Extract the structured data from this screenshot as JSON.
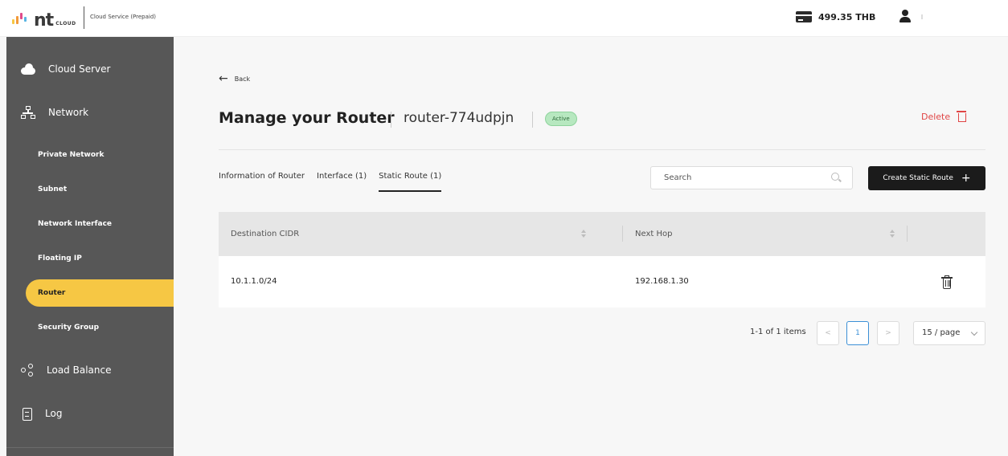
{
  "header": {
    "logo_text": "nt",
    "logo_sub": "CLOUD",
    "service": "Cloud Service (Prepaid)",
    "balance": "499.35 THB",
    "logo_colors": [
      "#f6c744",
      "#f29a3a",
      "#e04a8a",
      "#58b4e3"
    ]
  },
  "sidebar": {
    "items": [
      {
        "label": "Cloud Server",
        "icon": "cloud-icon"
      },
      {
        "label": "Network",
        "icon": "network-icon"
      },
      {
        "label": "Private Network"
      },
      {
        "label": "Subnet"
      },
      {
        "label": "Network Interface"
      },
      {
        "label": "Floating IP"
      },
      {
        "label": "Router",
        "active": true
      },
      {
        "label": "Security Group"
      },
      {
        "label": "Load Balance",
        "icon": "share-icon"
      },
      {
        "label": "Log",
        "icon": "clipboard-icon"
      }
    ]
  },
  "main": {
    "back_label": "Back",
    "title": "Manage your Router",
    "router_name": "router-774udpjn",
    "status": "Active",
    "delete_label": "Delete",
    "tabs": [
      {
        "label": "Information of Router"
      },
      {
        "label": "Interface (1)"
      },
      {
        "label": "Static Route (1)",
        "active": true
      }
    ],
    "search": {
      "placeholder": "Search"
    },
    "create_label": "Create Static Route",
    "create_plus": "+",
    "table": {
      "columns": [
        "Destination CIDR",
        "Next Hop"
      ],
      "rows": [
        {
          "destination": "10.1.1.0/24",
          "next_hop": "192.168.1.30"
        }
      ]
    },
    "pagination": {
      "info": "1-1 of 1 items",
      "prev": "<",
      "current": "1",
      "next": ">",
      "page_size": "15 / page"
    }
  },
  "colors": {
    "sidebar_bg": "#575757",
    "active_item": "#f6c744",
    "delete": "#e04545",
    "status_badge": "#b7e8c0"
  }
}
